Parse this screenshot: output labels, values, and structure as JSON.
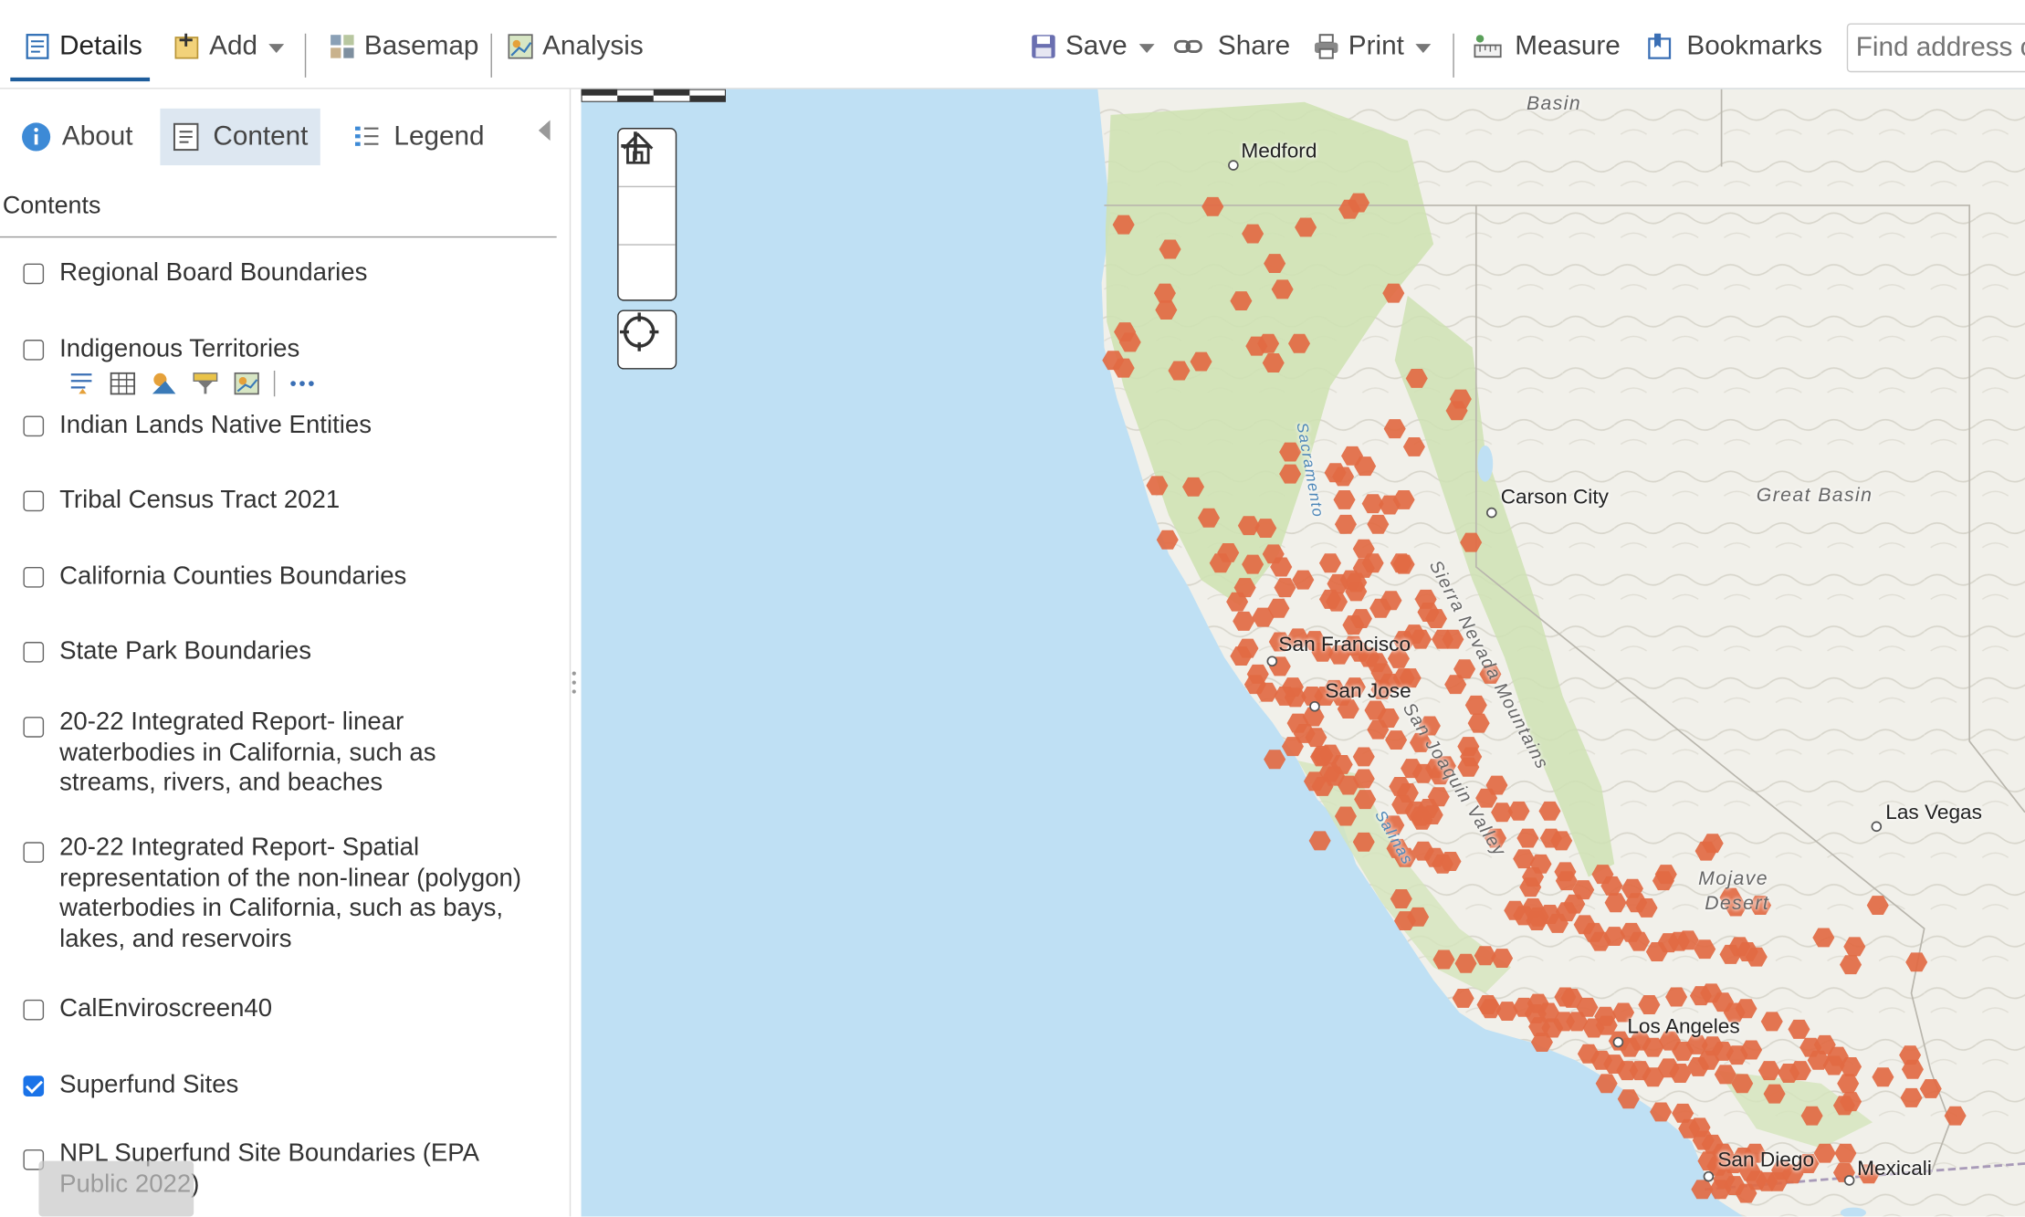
{
  "toolbar": {
    "details": "Details",
    "add": "Add",
    "basemap": "Basemap",
    "analysis": "Analysis",
    "save": "Save",
    "share": "Share",
    "print": "Print",
    "measure": "Measure",
    "bookmarks": "Bookmarks",
    "search_placeholder": "Find address o"
  },
  "panel": {
    "tabs": {
      "about": "About",
      "content": "Content",
      "legend": "Legend"
    },
    "contents_title": "Contents",
    "layers": [
      {
        "label": "Regional Board Boundaries",
        "checked": false
      },
      {
        "label": "Indigenous Territories",
        "checked": false
      },
      {
        "label": "Indian Lands Native Entities",
        "checked": false
      },
      {
        "label": "Tribal Census Tract 2021",
        "checked": false
      },
      {
        "label": "California Counties Boundaries",
        "checked": false
      },
      {
        "label": "State Park Boundaries",
        "checked": false
      },
      {
        "label": "20-22 Integrated Report- linear waterbodies in California, such as streams, rivers, and beaches",
        "checked": false
      },
      {
        "label": "20-22 Integrated Report- Spatial representation of the non-linear (polygon) waterbodies in California, such as bays, lakes, and reservoirs",
        "checked": false
      },
      {
        "label": "CalEnviroscreen40",
        "checked": false
      },
      {
        "label": "Superfund Sites",
        "checked": true
      },
      {
        "label": "NPL Superfund Site Boundaries (EPA Public 2022)",
        "checked": false
      }
    ]
  },
  "map": {
    "labels": {
      "medford": "Medford",
      "carson_city": "Carson City",
      "san_francisco": "San Francisco",
      "san_jose": "San Jose",
      "las_vegas": "Las Vegas",
      "los_angeles": "Los Angeles",
      "san_diego": "San Diego",
      "mexicali": "Mexicali",
      "great_basin": "Great Basin",
      "basin": "Basin",
      "mojave": "Mojave",
      "desert": "Desert",
      "sierra": "Sierra Nevada Mountains",
      "san_joaquin": "San Joaquin Valley",
      "sacramento": "Sacramento",
      "salinas": "Salinas"
    },
    "colors": {
      "water": "#bfe0f4",
      "land": "#f1f0ea",
      "forest": "#cfe2b4",
      "marker": "#e26a43"
    }
  }
}
